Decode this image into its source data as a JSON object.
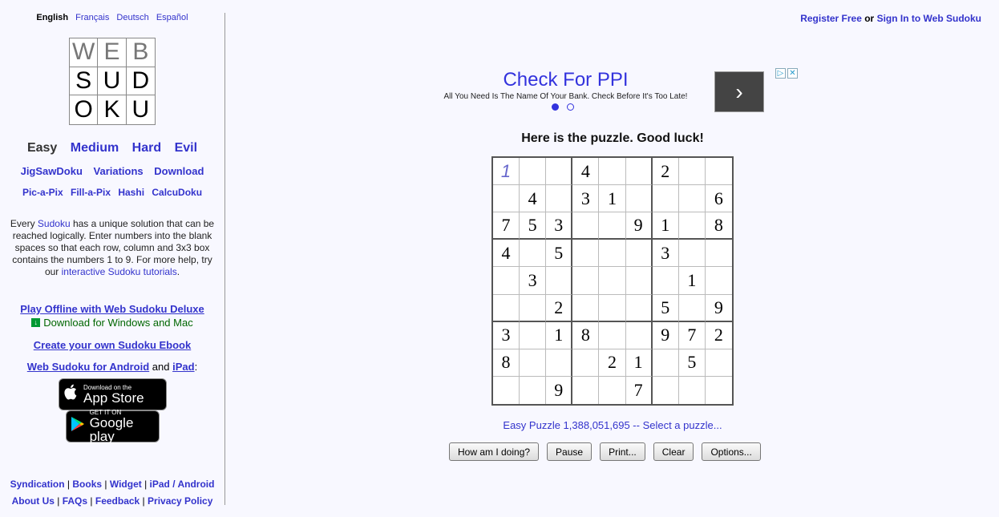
{
  "languages": [
    {
      "label": "English",
      "current": true
    },
    {
      "label": "Français",
      "current": false
    },
    {
      "label": "Deutsch",
      "current": false
    },
    {
      "label": "Español",
      "current": false
    }
  ],
  "logo": {
    "letters": [
      "W",
      "E",
      "B",
      "S",
      "U",
      "D",
      "O",
      "K",
      "U"
    ]
  },
  "levels": [
    {
      "label": "Easy",
      "current": true
    },
    {
      "label": "Medium",
      "current": false
    },
    {
      "label": "Hard",
      "current": false
    },
    {
      "label": "Evil",
      "current": false
    }
  ],
  "nav2": [
    "JigSawDoku",
    "Variations",
    "Download"
  ],
  "nav3": [
    "Pic-a-Pix",
    "Fill-a-Pix",
    "Hashi",
    "CalcuDoku"
  ],
  "intro": {
    "p1": "Every ",
    "link1": "Sudoku",
    "p2": " has a unique solution that can be reached logically. Enter numbers into the blank spaces so that each row, column and 3x3 box contains the numbers 1 to 9. For more help, try our ",
    "link2": "interactive Sudoku tutorials",
    "p3": "."
  },
  "offline": {
    "title": "Play Offline with Web Sudoku Deluxe",
    "download": "Download for Windows and Mac"
  },
  "ebook": "Create your own Sudoku Ebook",
  "android": {
    "link1": "Web Sudoku for Android",
    "and": " and ",
    "link2": "iPad",
    "colon": ":"
  },
  "appstore": {
    "small": "Download on the",
    "big": "App Store"
  },
  "googleplay": {
    "small": "GET IT ON",
    "big": "Google play"
  },
  "footer": {
    "row1": [
      "Syndication",
      "Books",
      "Widget",
      "iPad / Android"
    ],
    "row2": [
      "About Us",
      "FAQs",
      "Feedback",
      "Privacy Policy"
    ],
    "sep": " | "
  },
  "account": {
    "register": "Register Free",
    "or": " or ",
    "signin": "Sign In to Web Sudoku"
  },
  "ad": {
    "title": "Check For PPI",
    "text": "All You Need Is The Name Of Your Bank. Check Before It's Too Late!",
    "arrow": "›"
  },
  "puzzle": {
    "heading": "Here is the puzzle. Good luck!",
    "info": "Easy Puzzle 1,388,051,695 -- Select a puzzle...",
    "grid": [
      [
        "1",
        "",
        "",
        "4",
        "",
        "",
        "2",
        "",
        ""
      ],
      [
        "",
        "4",
        "",
        "3",
        "1",
        "",
        "",
        "",
        "6"
      ],
      [
        "7",
        "5",
        "3",
        "",
        "",
        "9",
        "1",
        "",
        "8"
      ],
      [
        "4",
        "",
        "5",
        "",
        "",
        "",
        "3",
        "",
        ""
      ],
      [
        "",
        "3",
        "",
        "",
        "",
        "",
        "",
        "1",
        ""
      ],
      [
        "",
        "",
        "2",
        "",
        "",
        "",
        "5",
        "",
        "9"
      ],
      [
        "3",
        "",
        "1",
        "8",
        "",
        "",
        "9",
        "7",
        "2"
      ],
      [
        "8",
        "",
        "",
        "",
        "2",
        "1",
        "",
        "5",
        ""
      ],
      [
        "",
        "",
        "9",
        "",
        "",
        "7",
        "",
        "",
        ""
      ]
    ],
    "entered": [
      [
        0,
        0
      ]
    ],
    "buttons": [
      "How am I doing?",
      "Pause",
      "Print...",
      "Clear",
      "Options..."
    ]
  }
}
